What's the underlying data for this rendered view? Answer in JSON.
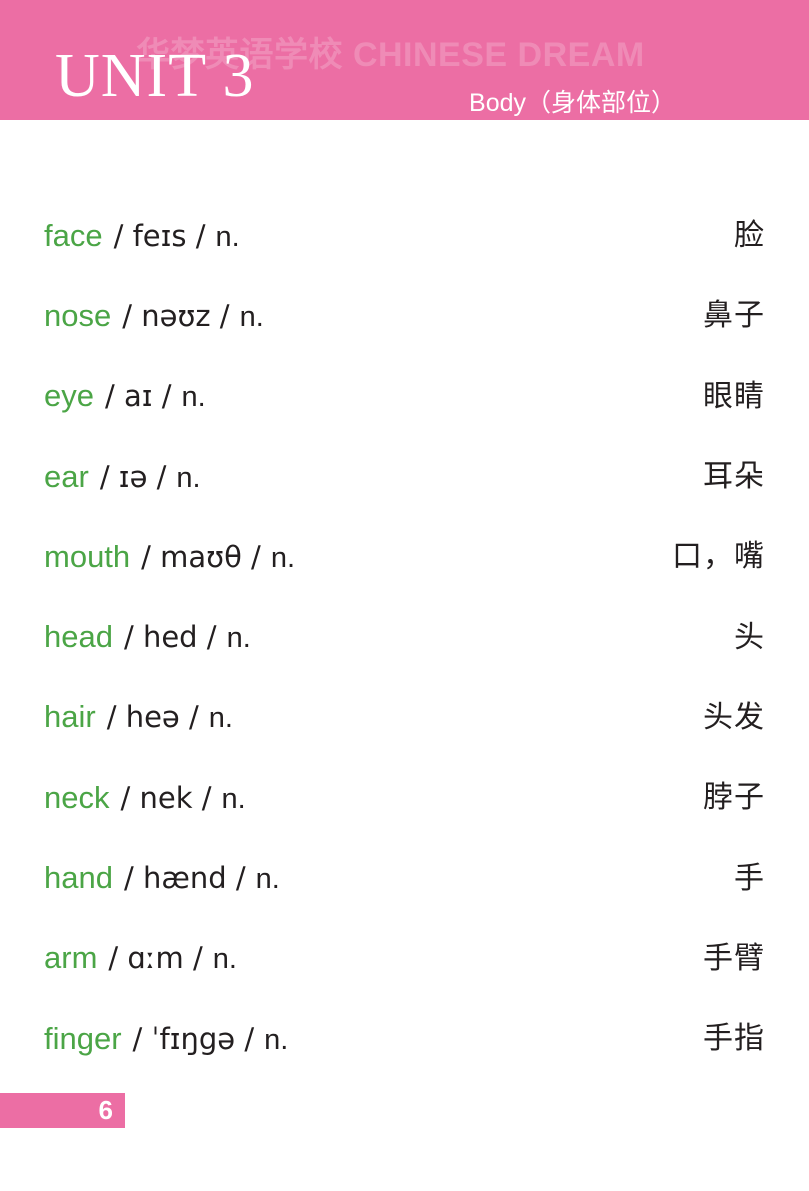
{
  "header": {
    "unit_title": "UNIT 3",
    "watermark": "华梦英语学校 CHINESE DREAM",
    "subtitle": "Body（身体部位）",
    "background_color": "#ec6ea4"
  },
  "colors": {
    "pink": "#ec6ea4",
    "green": "#4ba546",
    "text": "#231f20",
    "white": "#ffffff"
  },
  "words": [
    {
      "en": "face",
      "ipa": "/ feɪs /",
      "pos": "n.",
      "zh": "脸"
    },
    {
      "en": "nose",
      "ipa": "/ nəʊz /",
      "pos": "n.",
      "zh": "鼻子"
    },
    {
      "en": "eye",
      "ipa": "/ aɪ /",
      "pos": "n.",
      "zh": "眼睛"
    },
    {
      "en": "ear",
      "ipa": "/ ɪə /",
      "pos": "n.",
      "zh": "耳朵"
    },
    {
      "en": "mouth",
      "ipa": "/ maʊθ /",
      "pos": "n.",
      "zh": "口，嘴"
    },
    {
      "en": "head",
      "ipa": "/ hed /",
      "pos": "n.",
      "zh": "头"
    },
    {
      "en": "hair",
      "ipa": "/ heə /",
      "pos": "n.",
      "zh": "头发"
    },
    {
      "en": "neck",
      "ipa": "/ nek /",
      "pos": "n.",
      "zh": "脖子"
    },
    {
      "en": "hand",
      "ipa": "/ hænd /",
      "pos": "n.",
      "zh": "手"
    },
    {
      "en": "arm",
      "ipa": "/ ɑːm /",
      "pos": "n.",
      "zh": "手臂"
    },
    {
      "en": "finger",
      "ipa": "/ ˈfɪŋgə /",
      "pos": "n.",
      "zh": "手指"
    }
  ],
  "footer": {
    "page_number": "6"
  }
}
